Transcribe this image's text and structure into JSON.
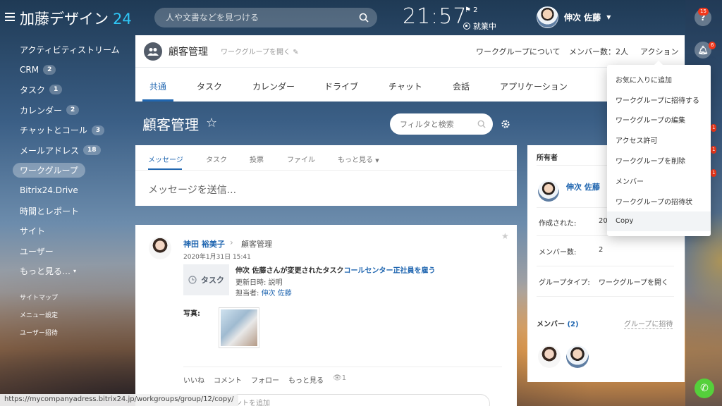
{
  "app": {
    "logo_text": "加藤デザイン",
    "logo_num": "24",
    "search_placeholder": "人や文書などを見つける",
    "clock": "21:57",
    "flag_count": "2",
    "work_status": "就業中",
    "user_name": "伸次 佐藤"
  },
  "rail": {
    "help_badge": "15",
    "notif_badge": "6",
    "side_badges": [
      "1",
      "1",
      "1"
    ]
  },
  "sidebar": {
    "items": [
      {
        "label": "アクティビティストリーム",
        "count": ""
      },
      {
        "label": "CRM",
        "count": "2"
      },
      {
        "label": "タスク",
        "count": "1"
      },
      {
        "label": "カレンダー",
        "count": "2"
      },
      {
        "label": "チャットとコール",
        "count": "3"
      },
      {
        "label": "メールアドレス",
        "count": "18"
      },
      {
        "label": "ワークグループ",
        "count": ""
      },
      {
        "label": "Bitrix24.Drive",
        "count": ""
      },
      {
        "label": "時間とレポート",
        "count": ""
      },
      {
        "label": "サイト",
        "count": ""
      },
      {
        "label": "ユーザー",
        "count": ""
      },
      {
        "label": "もっと見る…",
        "count": ""
      }
    ],
    "small_links": [
      "サイトマップ",
      "メニュー設定",
      "ユーザー招待"
    ]
  },
  "status_url": "https://mycompanyadress.bitrix24.jp/workgroups/group/12/copy/",
  "workgroup": {
    "title": "顧客管理",
    "open_label": "ワークグループを開く",
    "about": "ワークグループについて",
    "members": "メンバー数：2人",
    "action": "アクション"
  },
  "tabs": [
    "共通",
    "タスク",
    "カレンダー",
    "ドライブ",
    "チャット",
    "会話",
    "アプリケーション"
  ],
  "page": {
    "title": "顧客管理",
    "filter_placeholder": "フィルタと検索"
  },
  "composer": {
    "tabs": [
      "メッセージ",
      "タスク",
      "投票",
      "ファイル",
      "もっと見る"
    ],
    "placeholder": "メッセージを送信..."
  },
  "post": {
    "author": "神田 裕美子",
    "destination": "顧客管理",
    "date": "2020年1月31日 15:41",
    "task_label": "タスク",
    "line1_prefix": "伸次 佐藤さんが変更されたタスク",
    "line1_link": "コールセンター正社員を雇う",
    "line2": "更新日時: 説明",
    "line3_prefix": "担当者: ",
    "line3_link": "伸次 佐藤",
    "photo_label": "写真:",
    "actions": [
      "いいね",
      "コメント",
      "フォロー",
      "もっと見る"
    ],
    "views": "1",
    "comment_placeholder": "コメントを追加"
  },
  "info": {
    "owner_header": "所有者",
    "owner_name": "伸次 佐藤",
    "created_label": "作成された:",
    "created_value": "20",
    "members_label": "メンバー数:",
    "members_value": "2",
    "type_label": "グループタイプ:",
    "type_value": "ワークグループを開く",
    "members_header": "メンバー",
    "members_count": "(2)",
    "invite": "グループに招待"
  },
  "dropdown": {
    "items": [
      "お気に入りに追加",
      "ワークグループに招待する",
      "ワークグループの編集",
      "アクセス許可",
      "ワークグループを削除",
      "メンバー",
      "ワークグループの招待状",
      "Copy"
    ],
    "highlighted_index": 7
  },
  "colors": {
    "accent": "#2066b0",
    "logo_num": "#2fc6f6",
    "badge": "#f0371b",
    "phone": "#55d03b"
  }
}
